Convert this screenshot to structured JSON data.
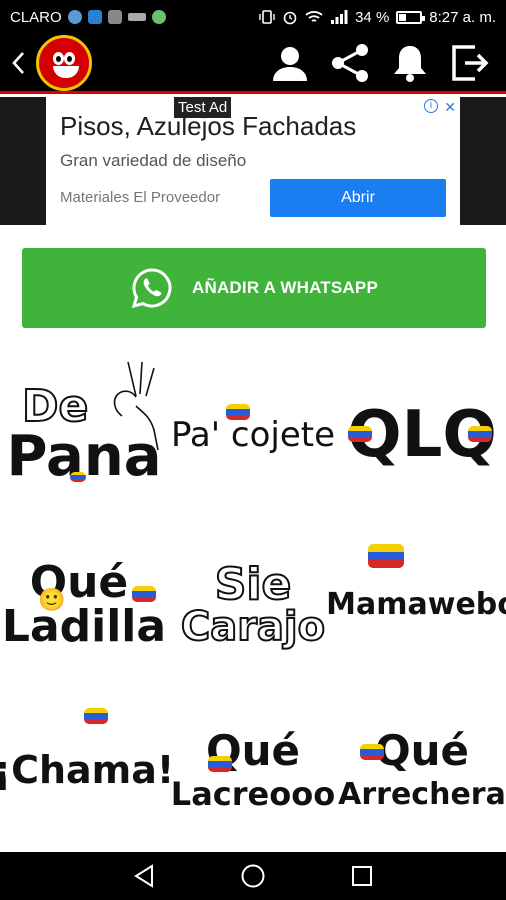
{
  "status_bar": {
    "carrier": "CLARO",
    "battery": "34 %",
    "time": "8:27 a. m."
  },
  "app_bar": {
    "back_icon": "back-arrow-icon",
    "actions": [
      "profile-icon",
      "share-icon",
      "bell-icon",
      "logout-icon"
    ],
    "accent_color": "#e00000"
  },
  "ad": {
    "label": "Test Ad",
    "title": "Pisos, Azulejos Fachadas",
    "subtitle": "Gran variedad de diseño",
    "advertiser": "Materiales El Proveedor",
    "cta": "Abrir"
  },
  "whatsapp": {
    "label": "AÑADIR A WHATSAPP",
    "color": "#3fb33a"
  },
  "stickers": [
    {
      "lines": [
        "De",
        "Pana"
      ]
    },
    {
      "lines": [
        "Pa' cojete"
      ]
    },
    {
      "lines": [
        "QLQ"
      ]
    },
    {
      "lines": [
        "Qué",
        "Ladilla"
      ]
    },
    {
      "lines": [
        "Sie",
        "Carajo"
      ]
    },
    {
      "lines": [
        "Mamawebo"
      ]
    },
    {
      "lines": [
        "¡Chama!"
      ]
    },
    {
      "lines": [
        "Qué",
        "Lacreooo"
      ]
    },
    {
      "lines": [
        "Qué",
        "Arrechera"
      ]
    }
  ]
}
